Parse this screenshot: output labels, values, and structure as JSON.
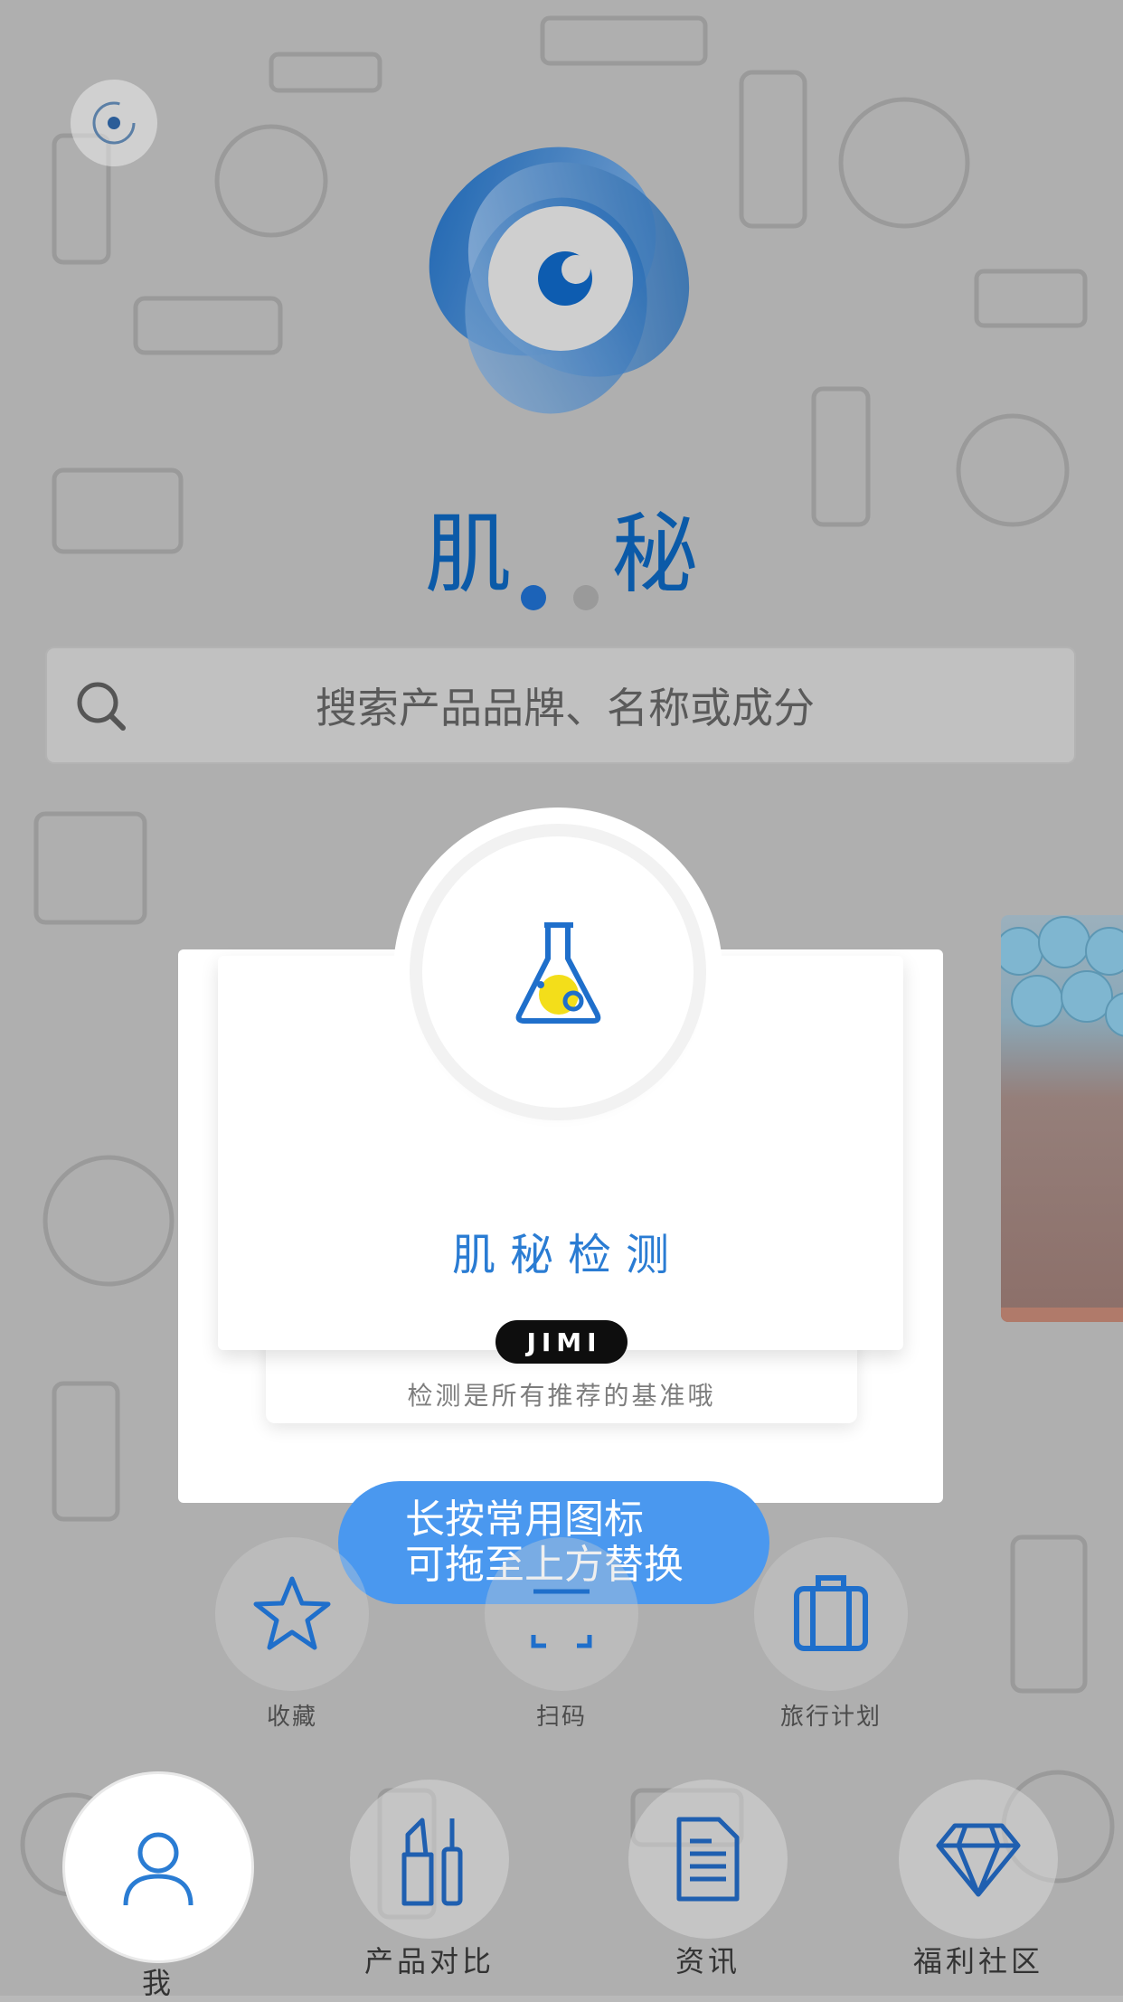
{
  "app": {
    "name": "肌 秘",
    "pager": {
      "pages": 2,
      "active": 0
    }
  },
  "search": {
    "placeholder": "搜索产品品牌、名称或成分"
  },
  "card": {
    "title": "肌秘检测",
    "brand": "JIMI",
    "tagline": "检测是所有推荐的基准哦",
    "icon": "flask-icon"
  },
  "tooltip": {
    "line1": "长按常用图标",
    "line2": "可拖至上方替换"
  },
  "quick_actions": [
    {
      "label": "收藏",
      "icon": "star-icon"
    },
    {
      "label": "扫码",
      "icon": "scan-icon"
    },
    {
      "label": "旅行计划",
      "icon": "suitcase-icon"
    }
  ],
  "bottom_nav": [
    {
      "label": "我",
      "icon": "user-icon"
    },
    {
      "label": "产品对比",
      "icon": "lipstick-icon"
    },
    {
      "label": "资讯",
      "icon": "document-icon"
    },
    {
      "label": "福利社区",
      "icon": "diamond-icon"
    }
  ],
  "colors": {
    "accent": "#2a7cd3",
    "logo_blue": "#0b5aa8",
    "tooltip_bg": "#4a98ef",
    "flask_yellow": "#f3de1a"
  }
}
